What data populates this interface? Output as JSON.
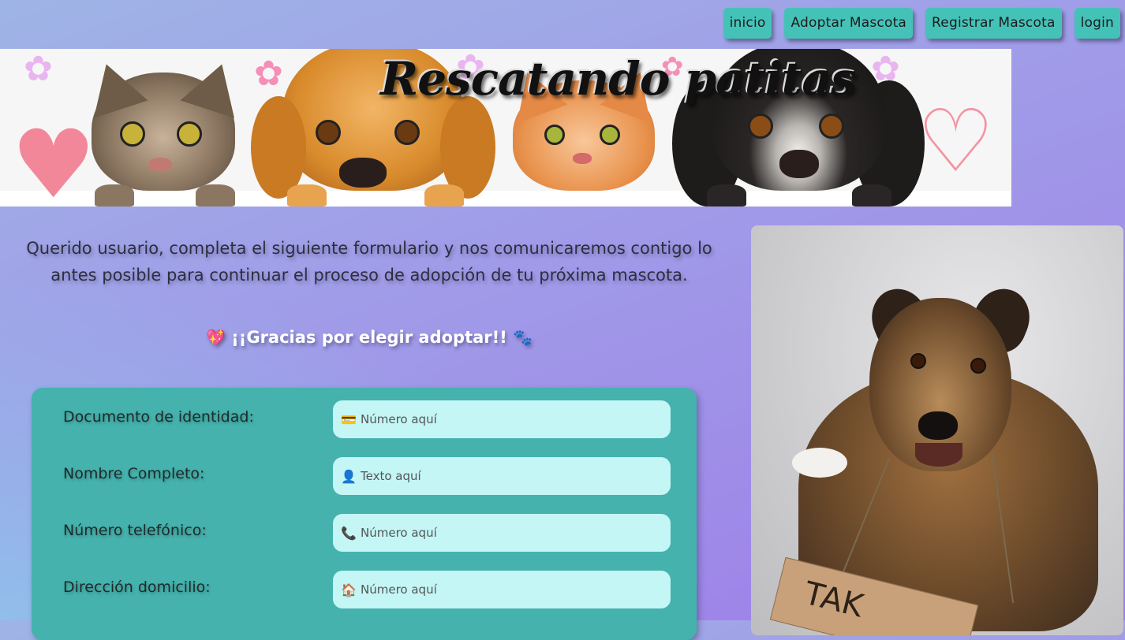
{
  "nav": {
    "items": [
      {
        "label": "inicio"
      },
      {
        "label": "Adoptar Mascota"
      },
      {
        "label": "Registrar Mascota"
      },
      {
        "label": "login"
      }
    ],
    "accent_color": "#45c2b7"
  },
  "banner": {
    "title": "Rescatando patitas"
  },
  "intro": {
    "text": "Querido usuario, completa el siguiente formulario y nos comunicaremos contigo lo antes posible para continuar el proceso de adopción de tu próxima mascota.",
    "thanks_text": "¡¡Gracias por elegir adoptar!!",
    "thanks_icon_left": "💖",
    "thanks_icon_right": "🐾"
  },
  "form": {
    "background_color": "#45b2ad",
    "fields": [
      {
        "label": "Documento de identidad:",
        "placeholder": "Número aquí",
        "icon": "💳",
        "icon_name": "credit-card-icon",
        "value": ""
      },
      {
        "label": "Nombre Completo:",
        "placeholder": "Texto aquí",
        "icon": "👤",
        "icon_name": "person-icon",
        "value": ""
      },
      {
        "label": "Número telefónico:",
        "placeholder": "Número aquí",
        "icon": "📞",
        "icon_name": "phone-icon",
        "value": ""
      },
      {
        "label": "Dirección domicilio:",
        "placeholder": "Número aquí",
        "icon": "🏠",
        "icon_name": "house-icon",
        "value": ""
      }
    ]
  },
  "photo": {
    "sign_text": "TAK"
  }
}
